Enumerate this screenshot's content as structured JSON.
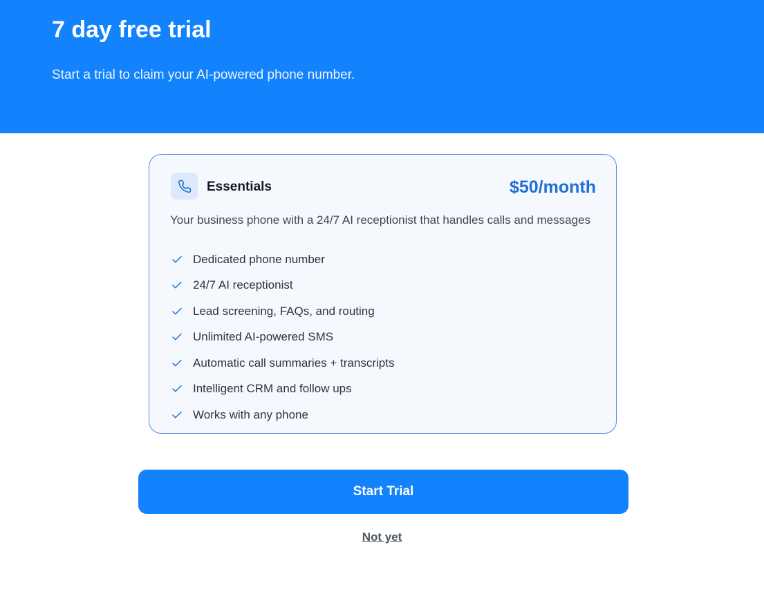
{
  "hero": {
    "title": "7 day free trial",
    "subtitle": "Start a trial to claim your AI-powered phone number."
  },
  "plan": {
    "icon": "phone-icon",
    "name": "Essentials",
    "price": "$50/month",
    "description": "Your business phone with a 24/7 AI receptionist that handles calls and messages",
    "features": [
      "Dedicated phone number",
      "24/7 AI receptionist",
      "Lead screening, FAQs, and routing",
      "Unlimited AI-powered SMS",
      "Automatic call summaries + transcripts",
      "Intelligent CRM and follow ups",
      "Works with any phone"
    ]
  },
  "actions": {
    "start_trial_label": "Start Trial",
    "not_yet_label": "Not yet"
  },
  "colors": {
    "brand_blue": "#1382fd",
    "price_blue": "#1f6fd6",
    "card_border": "#4a8ee6",
    "card_background": "#f5f9fe"
  }
}
